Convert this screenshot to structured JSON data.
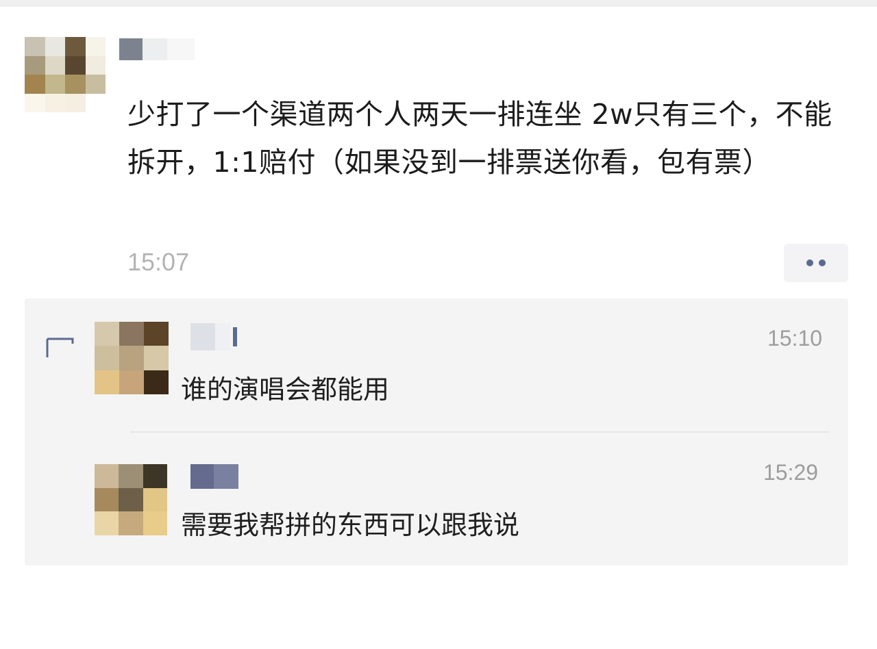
{
  "post": {
    "text": "少打了一个渠道两个人两天一排连坐 2w只有三个，不能拆开，1:1赔付（如果没到一排票送你看，包有票）",
    "time": "15:07"
  },
  "actions": {
    "more_icon": "ellipsis-icon"
  },
  "comments": [
    {
      "time": "15:10",
      "text": "谁的演唱会都能用"
    },
    {
      "time": "15:29",
      "text": "需要我帮拼的东西可以跟我说"
    }
  ],
  "colors": {
    "accent_name": "#5b6a8f",
    "timestamp": "#b3b3b3",
    "panel_bg": "#f4f4f4"
  }
}
